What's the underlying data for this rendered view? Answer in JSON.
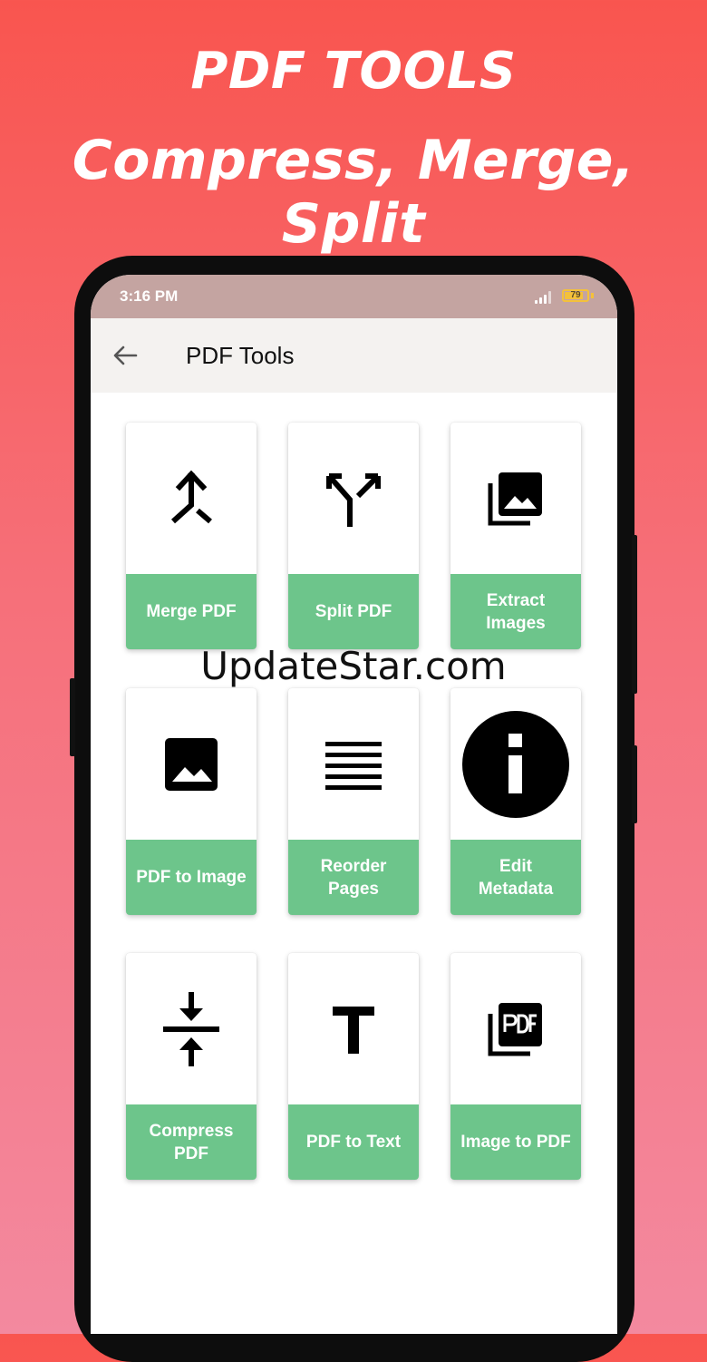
{
  "promo": {
    "line1": "PDF TOOLS",
    "line2": "Compress, Merge, Split"
  },
  "status_bar": {
    "time": "3:16 PM",
    "battery": "79"
  },
  "app_bar": {
    "title": "PDF Tools",
    "back_icon": "arrow-back-icon"
  },
  "tools": [
    {
      "label": "Merge PDF",
      "icon": "merge-icon"
    },
    {
      "label": "Split PDF",
      "icon": "split-icon"
    },
    {
      "label": "Extract\nImages",
      "icon": "image-library-icon"
    },
    {
      "label": "PDF to Image",
      "icon": "image-icon"
    },
    {
      "label": "Reorder\nPages",
      "icon": "reorder-lines-icon"
    },
    {
      "label": "Edit\nMetadata",
      "icon": "info-icon"
    },
    {
      "label": "Compress\nPDF",
      "icon": "compress-icon"
    },
    {
      "label": "PDF to Text",
      "icon": "text-icon"
    },
    {
      "label": "Image to PDF",
      "icon": "pdf-library-icon"
    }
  ],
  "watermark": "UpdateStar.com",
  "colors": {
    "accent_green": "#6dc58b",
    "background_top": "#f9554f",
    "background_bottom": "#f3899f",
    "status_bar": "#c4a4a1"
  }
}
